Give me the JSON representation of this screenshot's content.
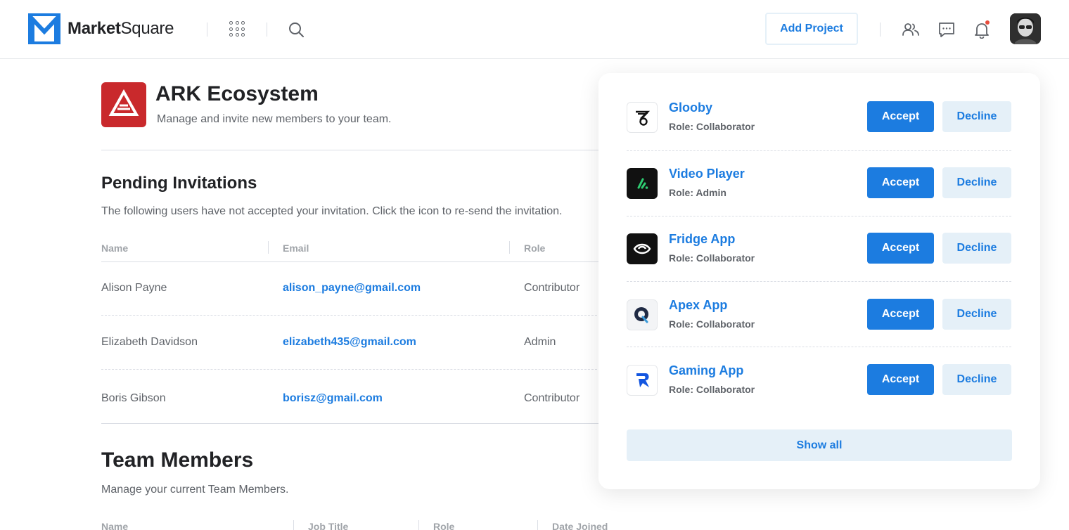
{
  "header": {
    "brand_bold": "Market",
    "brand_regular": "Square",
    "add_project_label": "Add Project",
    "icons": [
      "apps-grid-icon",
      "search-icon",
      "users-icon",
      "chat-icon",
      "bell-icon"
    ],
    "accent_color": "#1c7ce0",
    "notification_dot_color": "#e74c3c"
  },
  "organization": {
    "name": "ARK Ecosystem",
    "subtitle": "Manage and invite new members to your team.",
    "logo_color": "#c9292c"
  },
  "pending": {
    "title": "Pending Invitations",
    "description": "The following users have not accepted your invitation. Click the icon to re-send the invitation.",
    "columns": [
      "Name",
      "Email",
      "Role"
    ],
    "rows": [
      {
        "name": "Alison Payne",
        "email": "alison_payne@gmail.com",
        "role": "Contributor"
      },
      {
        "name": "Elizabeth Davidson",
        "email": "elizabeth435@gmail.com",
        "role": "Admin"
      },
      {
        "name": "Boris Gibson",
        "email": "borisz@gmail.com",
        "role": "Contributor"
      }
    ]
  },
  "team": {
    "title": "Team Members",
    "description": "Manage your current Team Members.",
    "columns": [
      "Name",
      "Job Title",
      "Role",
      "Date Joined"
    ]
  },
  "invitations_panel": {
    "accept_label": "Accept",
    "decline_label": "Decline",
    "show_all_label": "Show all",
    "items": [
      {
        "name": "Glooby",
        "role": "Role: Collaborator",
        "icon": "glooby-logo-icon"
      },
      {
        "name": "Video Player",
        "role": "Role: Admin",
        "icon": "video-player-logo-icon"
      },
      {
        "name": "Fridge App",
        "role": "Role: Collaborator",
        "icon": "fridge-app-logo-icon"
      },
      {
        "name": "Apex App",
        "role": "Role: Collaborator",
        "icon": "apex-app-logo-icon"
      },
      {
        "name": "Gaming App",
        "role": "Role: Collaborator",
        "icon": "gaming-app-logo-icon"
      }
    ]
  }
}
